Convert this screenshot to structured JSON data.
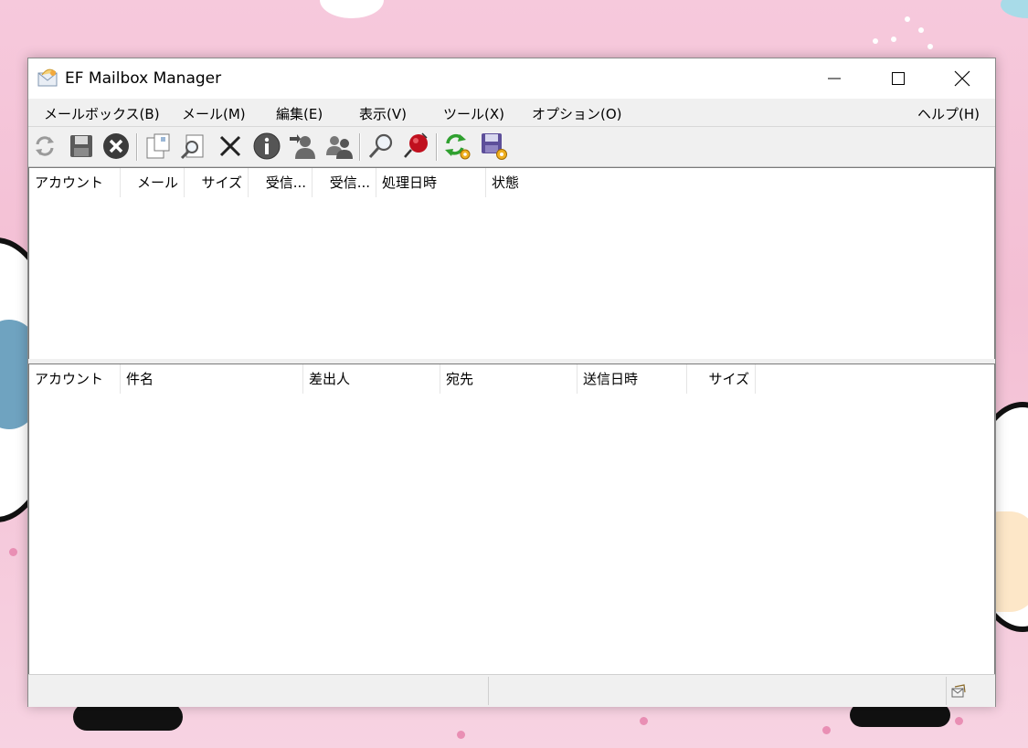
{
  "window": {
    "title": "EF Mailbox Manager"
  },
  "menu": [
    {
      "label": "メールボックス(B)"
    },
    {
      "label": "メール(M)"
    },
    {
      "label": "編集(E)"
    },
    {
      "label": "表示(V)"
    },
    {
      "label": "ツール(X)"
    },
    {
      "label": "オプション(O)"
    },
    {
      "label": "ヘルプ(H)"
    }
  ],
  "toolbar": [
    "refresh-icon",
    "save-icon",
    "cancel-icon",
    "copy-icon",
    "preview-icon",
    "delete-icon",
    "info-icon",
    "user-forward-icon",
    "users-icon",
    "search-icon",
    "filter-pin-icon",
    "sync-settings-icon",
    "save-settings-icon"
  ],
  "mailbox_list": {
    "columns": [
      "アカウント",
      "メール",
      "サイズ",
      "受信...",
      "受信...",
      "処理日時",
      "状態"
    ],
    "rows": []
  },
  "message_list": {
    "columns": [
      "アカウント",
      "件名",
      "差出人",
      "宛先",
      "送信日時",
      "サイズ"
    ],
    "rows": []
  },
  "statusbar": {
    "left": "",
    "middle": ""
  }
}
